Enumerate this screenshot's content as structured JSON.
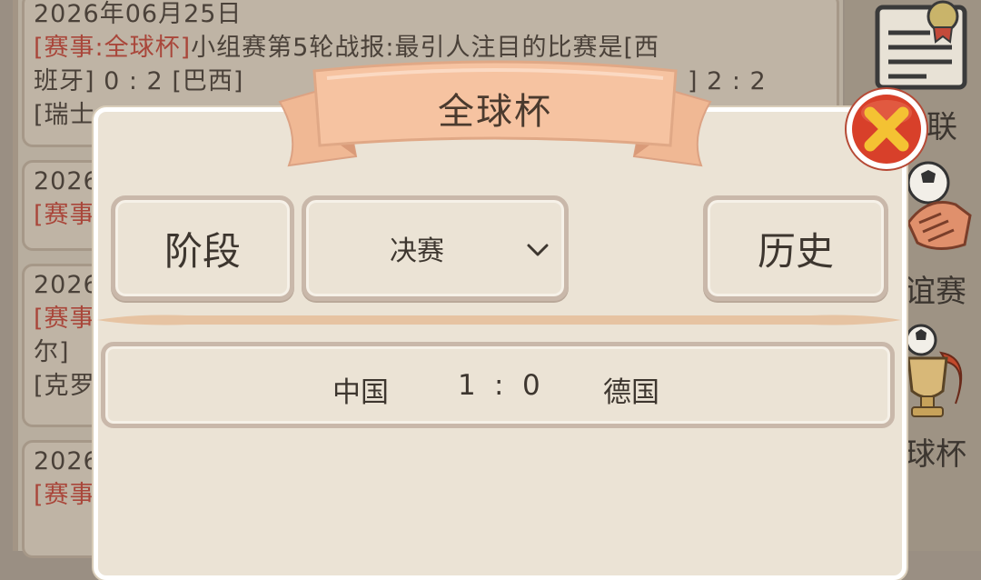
{
  "news": [
    {
      "date": "2026年06月25日",
      "tag": "[赛事:全球杯]",
      "line1_rest": "小组赛第5轮战报:最引人注目的比赛是[西",
      "line2": "班牙] 0 : 2 [巴西]",
      "line2_right": "] 2 : 2",
      "line3": "[瑞士"
    },
    {
      "date": "2026",
      "tag": "[赛事"
    },
    {
      "date": "2026",
      "tag": "[赛事",
      "line3": "尔]",
      "line4": "[克罗"
    },
    {
      "date": "2026",
      "tag": "[赛事"
    }
  ],
  "sidebar": {
    "items": [
      {
        "label": "联",
        "icon": "certificate-icon"
      },
      {
        "label": "谊赛",
        "icon": "handshake-ball-icon"
      },
      {
        "label": "球杯",
        "icon": "trophy-icon"
      }
    ]
  },
  "dialog": {
    "title": "全球杯",
    "stage_label": "阶段",
    "stage_value": "决赛",
    "history_label": "历史",
    "results": [
      {
        "home": "中国",
        "score_home": "1",
        "separator": ":",
        "score_away": "0",
        "away": "德国"
      }
    ]
  },
  "colors": {
    "accent_red": "#a9463a",
    "banner": "#f2b58d",
    "close_red": "#d8402a",
    "close_x": "#f4c233",
    "panel": "#ebe3d5",
    "border": "#c9b8aa"
  }
}
